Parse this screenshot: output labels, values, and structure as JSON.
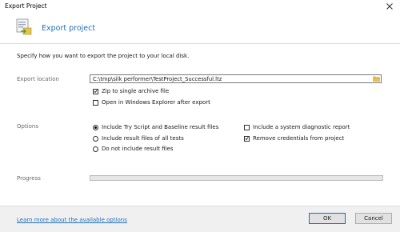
{
  "window": {
    "title": "Export Project"
  },
  "header": {
    "title": "Export project",
    "icon": "export-project-icon"
  },
  "intro": "Specify how you want to export the project to your local disk.",
  "export_location": {
    "label": "Export location",
    "path": "C:\\tmp\\silk performer\\TestProject_Successful.ltz",
    "zip": {
      "label": "Zip to single archive file",
      "checked": true
    },
    "open_explorer": {
      "label": "Open in Windows Explorer after export",
      "checked": false
    }
  },
  "options": {
    "label": "Options",
    "radios": [
      {
        "label": "Include Try Script and Baseline result files",
        "selected": true
      },
      {
        "label": "Include result files of all tests",
        "selected": false
      },
      {
        "label": "Do not include result files",
        "selected": false
      }
    ],
    "diag": {
      "label": "Include a system diagnostic report",
      "checked": false
    },
    "remove_credentials": {
      "label": "Remove credentials from project",
      "checked": true
    }
  },
  "progress": {
    "label": "Progress",
    "value": 0
  },
  "footer": {
    "link": "Learn more about the available options",
    "ok": "OK",
    "cancel": "Cancel"
  },
  "colors": {
    "accent": "#1f6fb8",
    "link": "#1f6fb8",
    "footer_bg": "#f0f0f0"
  }
}
